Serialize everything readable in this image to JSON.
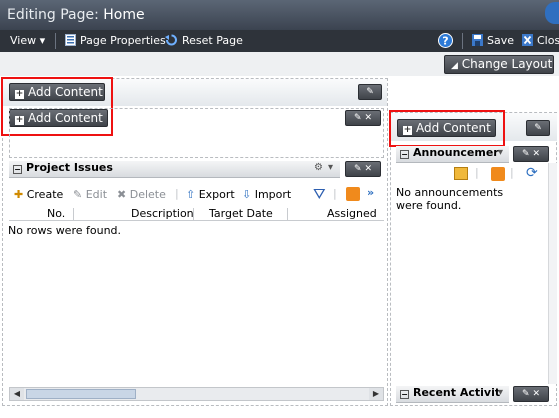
{
  "title": {
    "prefix": "Editing Page:",
    "page": "Home"
  },
  "toolbar": {
    "view": "View",
    "page_properties": "Page Properties",
    "reset_page": "Reset Page",
    "save": "Save",
    "close": "Clos"
  },
  "change_layout": "Change Layout",
  "add_content": "Add Content",
  "project_issues": {
    "title": "Project Issues",
    "actions": {
      "create": "Create",
      "edit": "Edit",
      "delete": "Delete",
      "export": "Export",
      "import": "Import"
    },
    "columns": [
      "No.",
      "Description",
      "Target Date",
      "Assigned"
    ],
    "empty": "No rows were found."
  },
  "announcements": {
    "title": "Announcemer",
    "empty": "No announcements were found."
  },
  "recent_activity": {
    "title": "Recent Activit"
  },
  "colors": {
    "titlebar": "#4c5562",
    "toolbar": "#2e333a",
    "highlight": "#e11111"
  }
}
